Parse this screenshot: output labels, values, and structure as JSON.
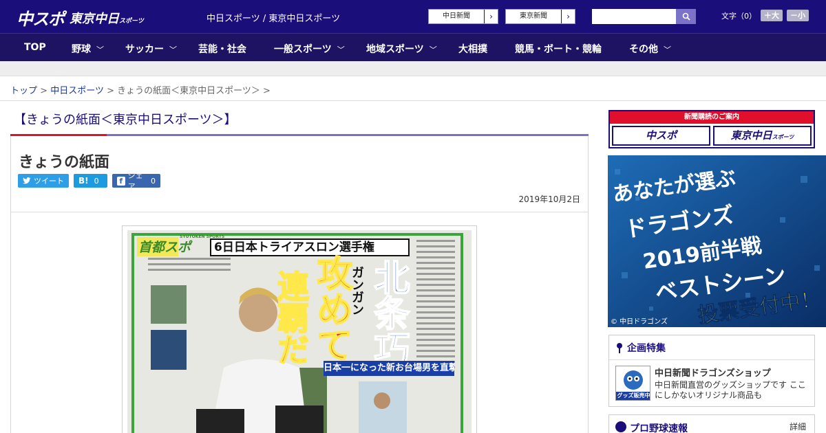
{
  "header": {
    "logo_main": "中スポ",
    "logo_sub": "東京中日",
    "logo_sub_small": "スポーツ",
    "title": "中日スポーツ / 東京中日スポーツ",
    "ext_links": [
      "中日新聞",
      "東京新聞"
    ],
    "search_placeholder": "",
    "font_size_label": "文字（0）",
    "font_bigger": "＋大",
    "font_smaller": "－小"
  },
  "nav": {
    "items": [
      {
        "label": "TOP",
        "chevron": false
      },
      {
        "label": "野球",
        "chevron": true
      },
      {
        "label": "サッカー",
        "chevron": true
      },
      {
        "label": "芸能・社会",
        "chevron": false
      },
      {
        "label": "一般スポーツ",
        "chevron": true
      },
      {
        "label": "地域スポーツ",
        "chevron": true
      },
      {
        "label": "大相撲",
        "chevron": false
      },
      {
        "label": "競馬・ボート・競輪",
        "chevron": false
      },
      {
        "label": "その他",
        "chevron": true
      }
    ]
  },
  "breadcrumb": {
    "items": [
      "トップ",
      "中日スポーツ",
      "きょうの紙面＜東京中日スポーツ＞"
    ],
    "sep": ">"
  },
  "main": {
    "section_title": "【きょうの紙面＜東京中日スポーツ＞】",
    "heading": "きょうの紙面",
    "share": {
      "tweet": "ツイート",
      "hatena_icon": "B!",
      "hatena_count": "0",
      "fb_icon": "f",
      "fb_label": "シェア",
      "fb_count": "0"
    },
    "date": "2019年10月2日"
  },
  "paper": {
    "brand": "首都スポ",
    "brand_en": "SYUTOKEN SPORTS",
    "header_line": "6日日本トライアスロン選手権",
    "headline_1": "北条巧",
    "headline_2": "ガンガン",
    "headline_3": "攻めて",
    "headline_4": "連覇だ",
    "sub": "日本一になった新お台場男を直撃"
  },
  "sidebar": {
    "sub_title": "新聞購読のご案内",
    "sub_btn1": "中スポ",
    "sub_btn2": "東京中日",
    "sub_btn2_small": "スポーツ",
    "banner_l1": "あなたが選ぶ",
    "banner_l2": "ドラゴンズ",
    "banner_l3": "2019前半戦",
    "banner_l4": "ベストシーン",
    "banner_l5": "投票受付中！",
    "banner_credit": "© 中日ドラゴンズ",
    "kikaku_title": "企画特集",
    "kikaku_thumb_label": "グッズ販売中",
    "kikaku_item_title": "中日新聞ドラゴンズショップ",
    "kikaku_item_desc": "中日新聞直営のグッズショップです ここにしかないオリジナル商品も",
    "baseball_title": "プロ野球速報",
    "baseball_more": "詳細"
  },
  "colors": {
    "header_bg": "#1a0e7a",
    "nav_bg": "#1e1263",
    "accent_red": "#e0102c",
    "accent_purple": "#7d70c0"
  }
}
